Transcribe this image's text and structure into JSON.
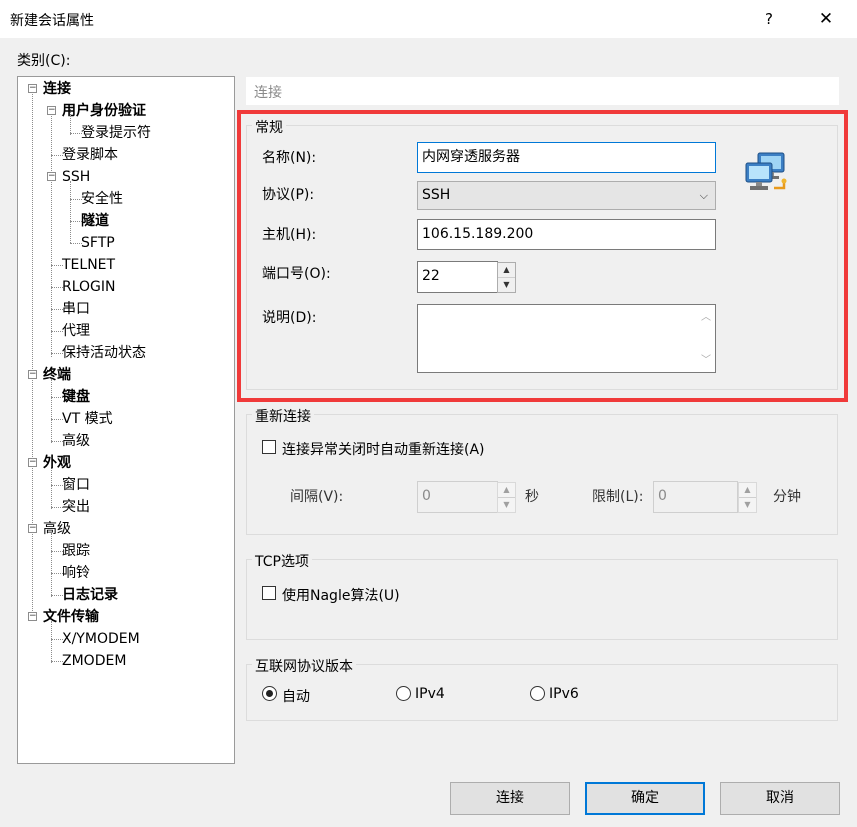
{
  "window": {
    "title": "新建会话属性",
    "help_glyph": "?",
    "close_glyph": "✕"
  },
  "category_label": "类别(C):",
  "tree": {
    "items": [
      {
        "label": "连接",
        "bold": true,
        "expander": "−"
      },
      {
        "label": "用户身份验证",
        "bold": true,
        "expander": "−"
      },
      {
        "label": "登录提示符",
        "bold": false
      },
      {
        "label": "登录脚本",
        "bold": false
      },
      {
        "label": "SSH",
        "bold": false,
        "expander": "−"
      },
      {
        "label": "安全性",
        "bold": false
      },
      {
        "label": "隧道",
        "bold": true
      },
      {
        "label": "SFTP",
        "bold": false
      },
      {
        "label": "TELNET",
        "bold": false
      },
      {
        "label": "RLOGIN",
        "bold": false
      },
      {
        "label": "串口",
        "bold": false
      },
      {
        "label": "代理",
        "bold": false
      },
      {
        "label": "保持活动状态",
        "bold": false
      },
      {
        "label": "终端",
        "bold": true,
        "expander": "−"
      },
      {
        "label": "键盘",
        "bold": true
      },
      {
        "label": "VT 模式",
        "bold": false
      },
      {
        "label": "高级",
        "bold": false
      },
      {
        "label": "外观",
        "bold": true,
        "expander": "−"
      },
      {
        "label": "窗口",
        "bold": false
      },
      {
        "label": "突出",
        "bold": false
      },
      {
        "label": "高级",
        "bold": false,
        "expander": "−"
      },
      {
        "label": "跟踪",
        "bold": false
      },
      {
        "label": "响铃",
        "bold": false
      },
      {
        "label": "日志记录",
        "bold": true
      },
      {
        "label": "文件传输",
        "bold": true,
        "expander": "−"
      },
      {
        "label": "X/YMODEM",
        "bold": false
      },
      {
        "label": "ZMODEM",
        "bold": false
      }
    ]
  },
  "section_header": "连接",
  "general": {
    "title": "常规",
    "name_label": "名称(N):",
    "name_value": "内网穿透服务器",
    "protocol_label": "协议(P):",
    "protocol_value": "SSH",
    "host_label": "主机(H):",
    "host_value": "106.15.189.200",
    "port_label": "端口号(O):",
    "port_value": "22",
    "desc_label": "说明(D):",
    "desc_value": ""
  },
  "reconnect": {
    "title": "重新连接",
    "checkbox_label": "连接异常关闭时自动重新连接(A)",
    "checked": false,
    "interval_label": "间隔(V):",
    "interval_value": "0",
    "interval_unit": "秒",
    "limit_label": "限制(L):",
    "limit_value": "0",
    "limit_unit": "分钟"
  },
  "tcp": {
    "title": "TCP选项",
    "nagle_label": "使用Nagle算法(U)",
    "checked": false
  },
  "ip_version": {
    "title": "互联网协议版本",
    "options": [
      "自动",
      "IPv4",
      "IPv6"
    ],
    "selected": "自动"
  },
  "buttons": {
    "connect": "连接",
    "ok": "确定",
    "cancel": "取消"
  },
  "icons": {
    "session": "network-computers-icon",
    "spin_up": "▲",
    "spin_down": "▼",
    "combo_arrow": "⌵",
    "scroll_up": "︿",
    "scroll_down": "﹀"
  },
  "colors": {
    "highlight_frame": "#f03a3a",
    "focus_border": "#0078d7"
  }
}
